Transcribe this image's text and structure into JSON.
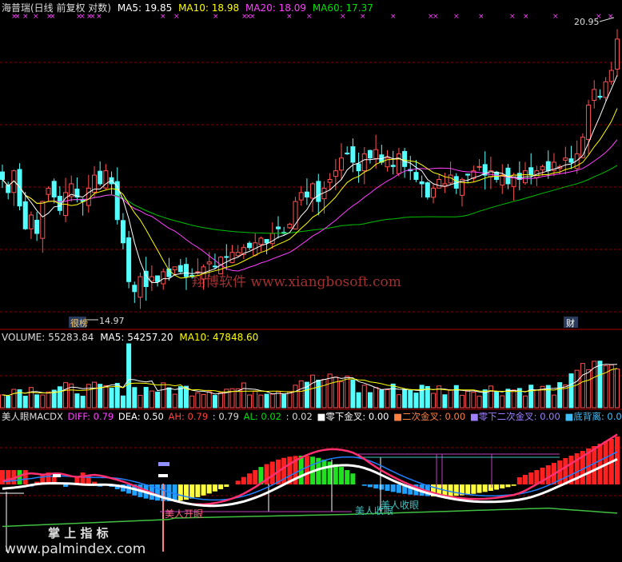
{
  "price_panel": {
    "legend": {
      "name": "海普瑞(日线 前复权 对数)",
      "ma5": "MA5: 19.85",
      "ma10": "MA10: 18.98",
      "ma20": "MA20: 18.09",
      "ma60": "MA60: 17.37"
    },
    "high_label": "20.95",
    "low_label": "14.97",
    "marker_left": "很榜",
    "marker_right": "财",
    "watermark": "翔博软件 www.xiangbosoft.com"
  },
  "volume_panel": {
    "legend": {
      "volume": "VOLUME: 55283.84",
      "ma5": "MA5: 54257.20",
      "ma10": "MA10: 47848.60"
    }
  },
  "macd_panel": {
    "legend": {
      "name": "美人眼MACDX",
      "diff": "DIFF: 0.79",
      "dea": "DEA: 0.50",
      "ah": "AH: 0.79",
      "x": ": 0.79",
      "al": "AL: 0.02",
      "y": ": 0.02",
      "zero_cross": "■零下金叉: 0.00",
      "second_cross": "■二次金叉: 0.00",
      "second_zero_cross": "■零下二次金叉: 0.00",
      "bottom_div": "■底背离: 0.00"
    },
    "labels": {
      "open_eye": "美人开眼",
      "close_eye": "美人收眼"
    },
    "watermark_cn": "掌 上 指 标",
    "watermark_url": "www.palmindex.com"
  },
  "colors": {
    "up": "#ff5050",
    "down": "#54ffff",
    "ma5": "#ffffff",
    "ma10": "#ffff00",
    "ma20": "#ff40ff",
    "ma60": "#00c000",
    "diff": "#ff40ff",
    "dea": "#ffffff",
    "grid": "#800000"
  },
  "chart_data": [
    {
      "type": "candlestick",
      "title": "海普瑞(日线 前复权 对数)",
      "scale": "log",
      "ylim": [
        14.3,
        21.6
      ],
      "marked_high": 20.95,
      "marked_low": 14.97,
      "series": [
        {
          "name": "MA5",
          "last": 19.85
        },
        {
          "name": "MA10",
          "last": 18.98
        },
        {
          "name": "MA20",
          "last": 18.09
        },
        {
          "name": "MA60",
          "last": 17.37
        }
      ],
      "close": [
        17.4,
        17.1,
        17.6,
        16.8,
        16.3,
        16.6,
        16.2,
        16.9,
        17.2,
        17.0,
        16.7,
        17.1,
        17.3,
        17.0,
        16.9,
        17.2,
        17.5,
        17.3,
        17.6,
        17.3,
        16.5,
        16.0,
        15.2,
        15.0,
        15.3,
        15.1,
        15.3,
        15.2,
        15.4,
        15.3,
        15.5,
        15.4,
        15.3,
        15.3,
        15.4,
        15.5,
        15.6,
        15.5,
        15.7,
        15.7,
        15.8,
        15.8,
        15.9,
        15.9,
        16.0,
        16.1,
        16.0,
        16.2,
        16.3,
        16.2,
        16.4,
        16.9,
        17.1,
        17.0,
        17.3,
        16.9,
        17.2,
        17.4,
        17.6,
        17.9,
        18.0,
        17.8,
        17.6,
        18.0,
        17.9,
        18.1,
        17.8,
        17.9,
        17.7,
        18.0,
        17.7,
        17.6,
        17.4,
        17.3,
        17.0,
        17.2,
        17.4,
        17.3,
        17.5,
        17.2,
        17.4,
        17.5,
        17.6,
        17.7,
        17.5,
        17.6,
        17.4,
        17.5,
        17.3,
        17.5,
        17.4,
        17.6,
        17.5,
        17.6,
        17.7,
        17.6,
        17.8,
        17.7,
        17.9,
        17.8,
        18.0,
        18.4,
        19.2,
        19.6,
        19.4,
        19.8,
        20.1,
        20.95
      ],
      "volume_legend": {
        "VOLUME": 55283.84,
        "MA5": 54257.2,
        "MA10": 47848.6
      }
    },
    {
      "type": "bar",
      "title": "美人眼MACDX",
      "series": [
        {
          "name": "DIFF",
          "last": 0.79
        },
        {
          "name": "DEA",
          "last": 0.5
        },
        {
          "name": "AH",
          "last": 0.79
        },
        {
          "name": "AL",
          "last": 0.02
        }
      ]
    }
  ]
}
